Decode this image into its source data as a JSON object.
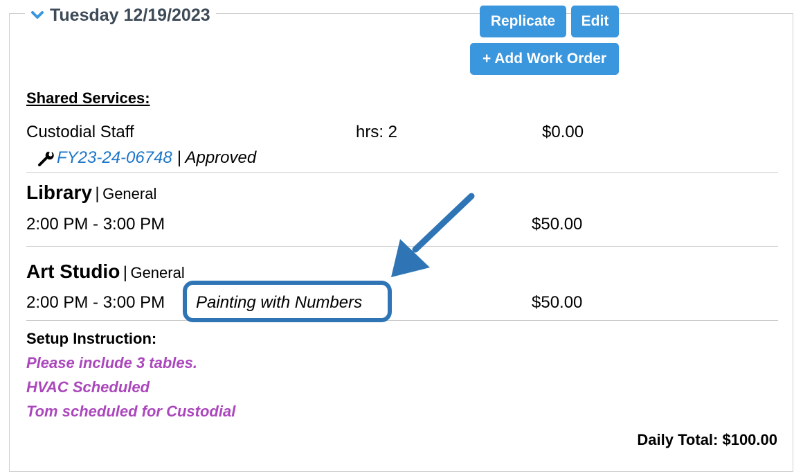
{
  "header": {
    "date": "Tuesday 12/19/2023",
    "replicate_label": "Replicate",
    "edit_label": "Edit",
    "add_work_order_label": "+ Add Work Order"
  },
  "shared_services": {
    "heading": "Shared Services:",
    "items": [
      {
        "name": "Custodial Staff",
        "hours": "hrs: 2",
        "price": "$0.00",
        "work_order_id": "FY23-24-06748",
        "status": "| Approved",
        "icon": "wrench-icon"
      }
    ]
  },
  "bookings": [
    {
      "venue": "Library",
      "separator": "|",
      "type": "General",
      "time": "2:00 PM - 3:00 PM",
      "event": "",
      "price": "$50.00"
    },
    {
      "venue": "Art Studio",
      "separator": "|",
      "type": "General",
      "time": "2:00 PM - 3:00 PM",
      "event": "Painting with Numbers",
      "price": "$50.00"
    }
  ],
  "setup": {
    "heading": "Setup Instruction:",
    "lines": [
      "Please include 3 tables.",
      "HVAC Scheduled",
      "Tom scheduled for Custodial"
    ]
  },
  "daily_total": "Daily Total: $100.00",
  "colors": {
    "button": "#3a96dd",
    "link": "#1d76c9",
    "instruction": "#ab47bc",
    "annotation": "#2f75b5"
  },
  "icons": [
    "chevron-down-icon",
    "wrench-icon",
    "arrow-annotation-icon"
  ]
}
